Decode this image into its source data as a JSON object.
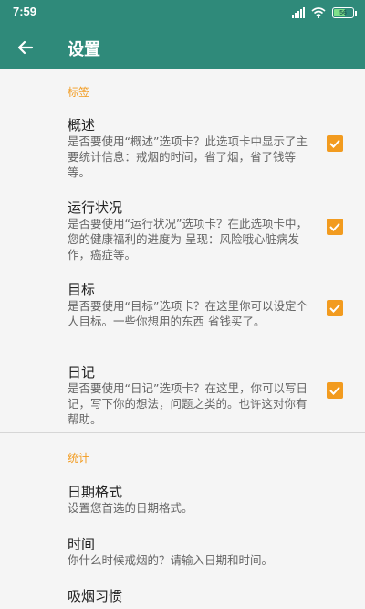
{
  "status_bar": {
    "time": "7:59",
    "battery": "56",
    "battery_level": 0.56,
    "icons": [
      "signal-icon",
      "wifi-icon",
      "battery-icon"
    ]
  },
  "app_bar": {
    "title": "设置",
    "back_icon": "arrow-left-icon"
  },
  "colors": {
    "primary": "#2f8a7a",
    "accent": "#f29b1f",
    "background": "#f5f5f5"
  },
  "sections": {
    "tabs": {
      "header": "标签",
      "items": [
        {
          "title": "概述",
          "summary": "是否要使用“概述”选项卡？此选项卡中显示了主要统计信息：戒烟的时间，省了烟，省了钱等等。",
          "checked": true
        },
        {
          "title": "运行状况",
          "summary": "是否要使用“运行状况”选项卡？在此选项卡中，您的健康福利的进度为 呈现：风险哦心脏病发作，癌症等。",
          "checked": true
        },
        {
          "title": "目标",
          "summary": "是否要使用“目标”选项卡？在这里你可以设定个人目标。一些你想用的东西 省钱买了。",
          "checked": true
        },
        {
          "title": "日记",
          "summary": "是否要使用“日记”选项卡？在这里，你可以写日记，写下你的想法，问题之类的。也许这对你有帮助。",
          "checked": true
        }
      ]
    },
    "stats": {
      "header": "统计",
      "items": [
        {
          "title": "日期格式",
          "summary": "设置您首选的日期格式。"
        },
        {
          "title": "时间",
          "summary": "你什么时候戒烟的？请输入日期和时间。"
        },
        {
          "title": "吸烟习惯",
          "summary": ""
        }
      ]
    }
  }
}
